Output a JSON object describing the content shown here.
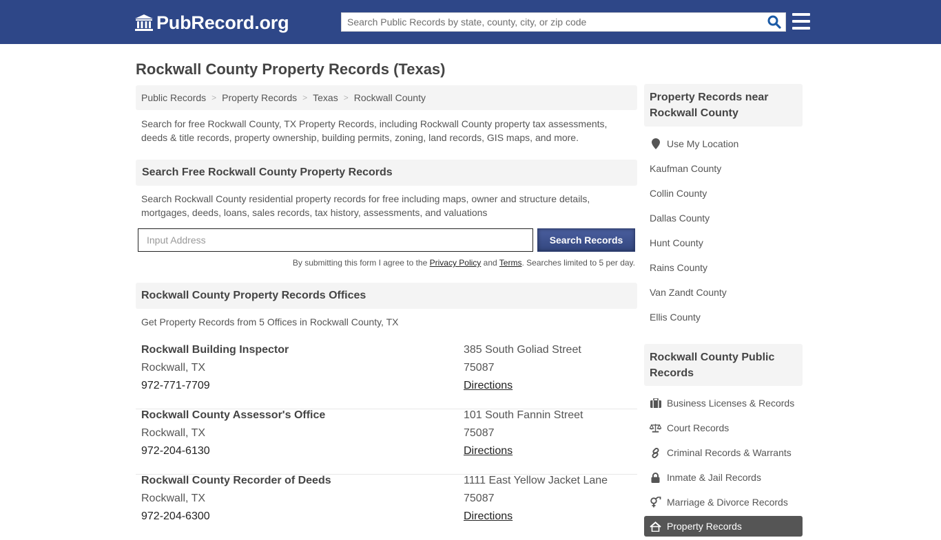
{
  "header": {
    "logo_text": "PubRecord.org",
    "search_placeholder": "Search Public Records by state, county, city, or zip code",
    "brand_color": "#2e4788"
  },
  "page": {
    "title": "Rockwall County Property Records (Texas)",
    "breadcrumb": [
      "Public Records",
      "Property Records",
      "Texas",
      "Rockwall County"
    ],
    "intro": "Search for free Rockwall County, TX Property Records, including Rockwall County property tax assessments, deeds & title records, property ownership, building permits, zoning, land records, GIS maps, and more."
  },
  "search_section": {
    "heading": "Search Free Rockwall County Property Records",
    "description": "Search Rockwall County residential property records for free including maps, owner and structure details, mortgages, deeds, loans, sales records, tax history, assessments, and valuations",
    "address_placeholder": "Input Address",
    "button_label": "Search Records",
    "disclaimer_prefix": "By submitting this form I agree to the ",
    "privacy_link": "Privacy Policy",
    "disclaimer_and": " and ",
    "terms_link": "Terms",
    "disclaimer_suffix": ". Searches limited to 5 per day."
  },
  "offices_section": {
    "heading": "Rockwall County Property Records Offices",
    "subtext": "Get Property Records from 5 Offices in Rockwall County, TX",
    "offices": [
      {
        "name": "Rockwall Building Inspector",
        "city": "Rockwall, TX",
        "phone": "972-771-7709",
        "street": "385 South Goliad Street",
        "zip": "75087",
        "directions": "Directions"
      },
      {
        "name": "Rockwall County Assessor's Office",
        "city": "Rockwall, TX",
        "phone": "972-204-6130",
        "street": "101 South Fannin Street",
        "zip": "75087",
        "directions": "Directions"
      },
      {
        "name": "Rockwall County Recorder of Deeds",
        "city": "Rockwall, TX",
        "phone": "972-204-6300",
        "street": "1111 East Yellow Jacket Lane",
        "zip": "75087",
        "directions": "Directions"
      }
    ]
  },
  "sidebar": {
    "near_heading": "Property Records near Rockwall County",
    "use_location": "Use My Location",
    "nearby": [
      "Kaufman County",
      "Collin County",
      "Dallas County",
      "Hunt County",
      "Rains County",
      "Van Zandt County",
      "Ellis County"
    ],
    "public_heading": "Rockwall County Public Records",
    "public_links": [
      {
        "label": "Business Licenses & Records",
        "icon": "briefcase-icon"
      },
      {
        "label": "Court Records",
        "icon": "scales-icon"
      },
      {
        "label": "Criminal Records & Warrants",
        "icon": "link-icon"
      },
      {
        "label": "Inmate & Jail Records",
        "icon": "lock-icon"
      },
      {
        "label": "Marriage & Divorce Records",
        "icon": "gender-icon"
      },
      {
        "label": "Property Records",
        "icon": "home-icon",
        "active": true
      }
    ]
  }
}
